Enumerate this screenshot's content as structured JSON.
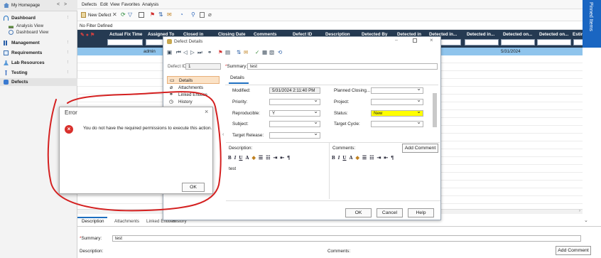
{
  "sidebar": {
    "home": "My Homepage",
    "items": [
      {
        "label": "Dashboard"
      },
      {
        "label": "Management"
      },
      {
        "label": "Requirements"
      },
      {
        "label": "Lab Resources"
      },
      {
        "label": "Testing"
      },
      {
        "label": "Defects"
      }
    ],
    "dashboard_sub": [
      "Analysis View",
      "Dashboard View"
    ]
  },
  "menubar": [
    "Defects",
    "Edit",
    "View",
    "Favorites",
    "Analysis"
  ],
  "toolbar": {
    "new_defect": "New Defect"
  },
  "filter_text": "No Filter Defined",
  "grid": {
    "headers": [
      "Actual Fix Time",
      "Assigned To",
      "Closed in",
      "Closing Date",
      "Comments",
      "Defect ID",
      "Description",
      "Detected By",
      "Detected in",
      "Detected in...",
      "Detected in...",
      "Detected on...",
      "Detected on...",
      "Estimate"
    ],
    "selected_row": {
      "assigned_to": "admin",
      "detected_on": "5/31/2024"
    }
  },
  "pinned_items": "Pinned Items",
  "dialog": {
    "title": "Defect Details",
    "defect_id_label": "Defect ID:",
    "defect_id": "1",
    "summary_label": "Summary:",
    "summary": "test",
    "nav": [
      "Details",
      "Attachments",
      "Linked Entities",
      "History"
    ],
    "tab": "Details",
    "fields_left": [
      {
        "label": "Modified:",
        "value": "5/31/2024 2:11:40 PM"
      },
      {
        "label": "Priority:",
        "value": ""
      },
      {
        "label": "Reproducible:",
        "value": "Y"
      },
      {
        "label": "Subject:",
        "value": ""
      },
      {
        "label": "Target Release:",
        "value": ""
      }
    ],
    "fields_right": [
      {
        "label": "Planned Closing...",
        "value": ""
      },
      {
        "label": "Project:",
        "value": ""
      },
      {
        "label": "Status:",
        "value": "New"
      },
      {
        "label": "Target Cycle:",
        "value": ""
      }
    ],
    "description_label": "Description:",
    "comments_label": "Comments:",
    "add_comment": "Add Comment",
    "description_text": "test",
    "buttons": {
      "ok": "OK",
      "cancel": "Cancel",
      "help": "Help"
    }
  },
  "error": {
    "title": "Error",
    "message": "You do not have the required permissions to execute this action.",
    "ok": "OK"
  },
  "bottom": {
    "tabs": [
      "Description",
      "Attachments",
      "Linked Entities",
      "History"
    ],
    "summary_label": "Summary:",
    "summary": "test",
    "description_label": "Description:",
    "comments_label": "Comments:",
    "add_comment": "Add Comment"
  },
  "colors": {
    "grid_header": "#253a52",
    "selected_row": "#8fc4ec",
    "status_highlight": "#ffff00",
    "annotation": "#d42020",
    "pinned": "#1a66c2"
  }
}
